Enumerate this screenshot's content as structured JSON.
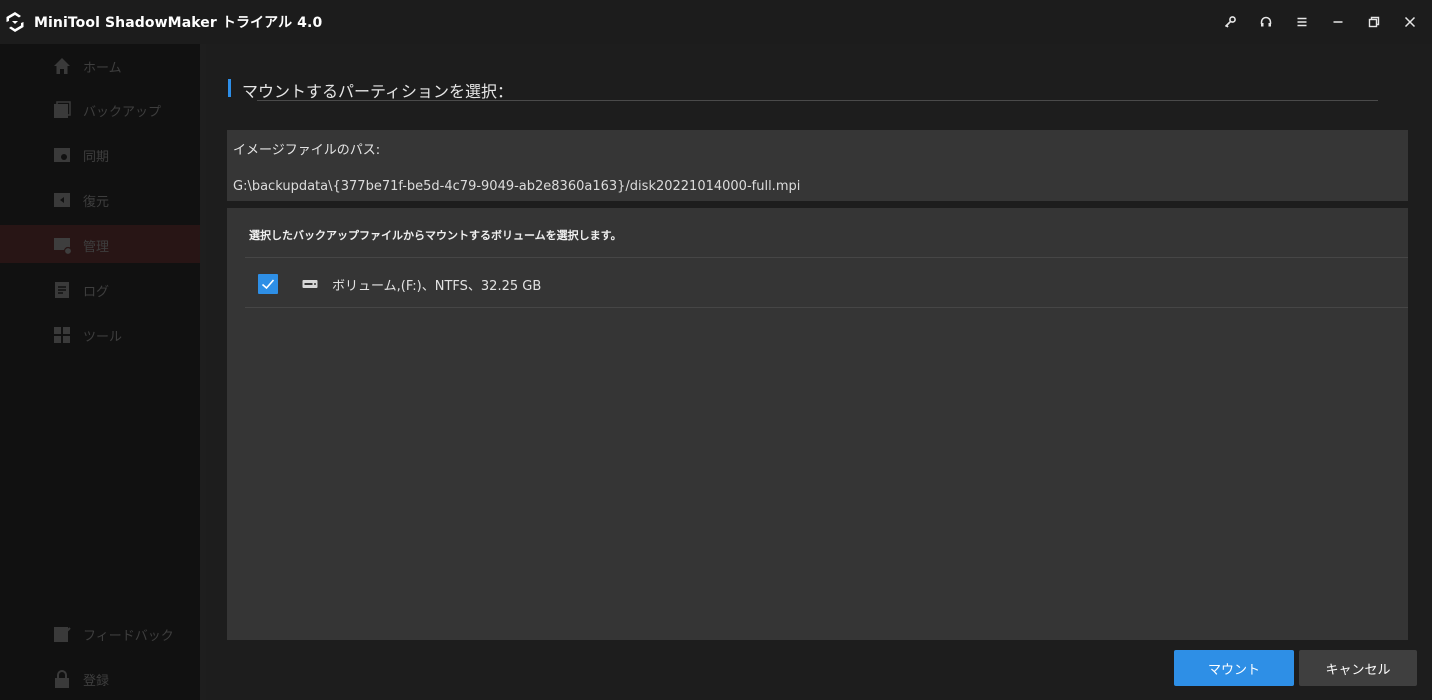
{
  "app": {
    "title": "MiniTool ShadowMaker トライアル 4.0"
  },
  "window_controls": {
    "icons": [
      "key-icon",
      "headset-icon",
      "menu-icon",
      "minimize-icon",
      "restore-icon",
      "close-icon"
    ]
  },
  "sidebar": {
    "items": [
      {
        "label": "ホーム",
        "icon": "home-icon"
      },
      {
        "label": "バックアップ",
        "icon": "backup-icon"
      },
      {
        "label": "同期",
        "icon": "sync-icon"
      },
      {
        "label": "復元",
        "icon": "restore-data-icon"
      },
      {
        "label": "管理",
        "icon": "manage-icon",
        "active": true
      },
      {
        "label": "ログ",
        "icon": "log-icon"
      },
      {
        "label": "ツール",
        "icon": "tools-icon"
      }
    ],
    "bottom": [
      {
        "label": "フィードバック",
        "icon": "feedback-icon"
      },
      {
        "label": "登録",
        "icon": "lock-icon"
      }
    ]
  },
  "dialog": {
    "section_title": "マウントするパーティションを選択：",
    "image_path_label": "イメージファイルのパス:",
    "image_path_value": "G:\\backupdata\\{377be71f-be5d-4c79-9049-ab2e8360a163}/disk20221014000-full.mpi",
    "volume_heading": "選択したバックアップファイルからマウントするボリュームを選択します。",
    "volumes": [
      {
        "label": "ボリューム,(F:)、NTFS、32.25 GB",
        "checked": true
      }
    ],
    "mount_button": "マウント",
    "cancel_button": "キャンセル"
  },
  "colors": {
    "accent": "#2e8fe6",
    "active_nav": "#281515"
  }
}
